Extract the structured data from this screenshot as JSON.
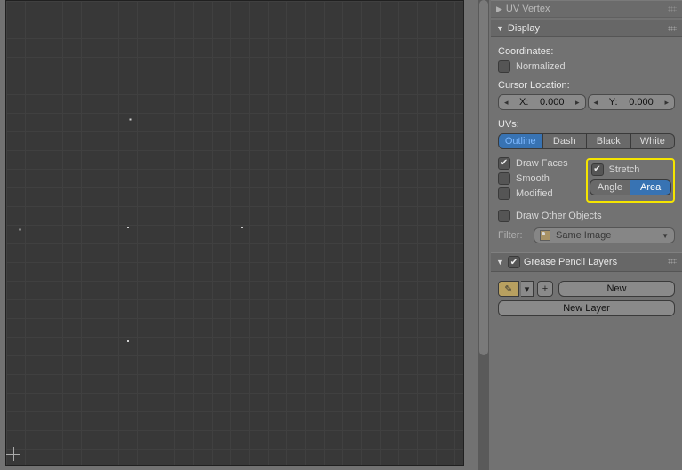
{
  "panels": {
    "uv_vertex": {
      "title": "UV Vertex"
    },
    "display": {
      "title": "Display",
      "coords_label": "Coordinates:",
      "normalized": "Normalized",
      "cursor_loc_label": "Cursor Location:",
      "cursor_x_label": "X:",
      "cursor_x_value": "0.000",
      "cursor_y_label": "Y:",
      "cursor_y_value": "0.000",
      "uvs_label": "UVs:",
      "draw_modes": [
        "Outline",
        "Dash",
        "Black",
        "White"
      ],
      "draw_faces": "Draw Faces",
      "smooth": "Smooth",
      "modified": "Modified",
      "stretch": "Stretch",
      "stretch_modes": [
        "Angle",
        "Area"
      ],
      "draw_other": "Draw Other Objects",
      "filter_label": "Filter:",
      "filter_value": "Same Image"
    },
    "grease": {
      "title": "Grease Pencil Layers",
      "new_label": "New",
      "new_layer": "New Layer"
    }
  }
}
